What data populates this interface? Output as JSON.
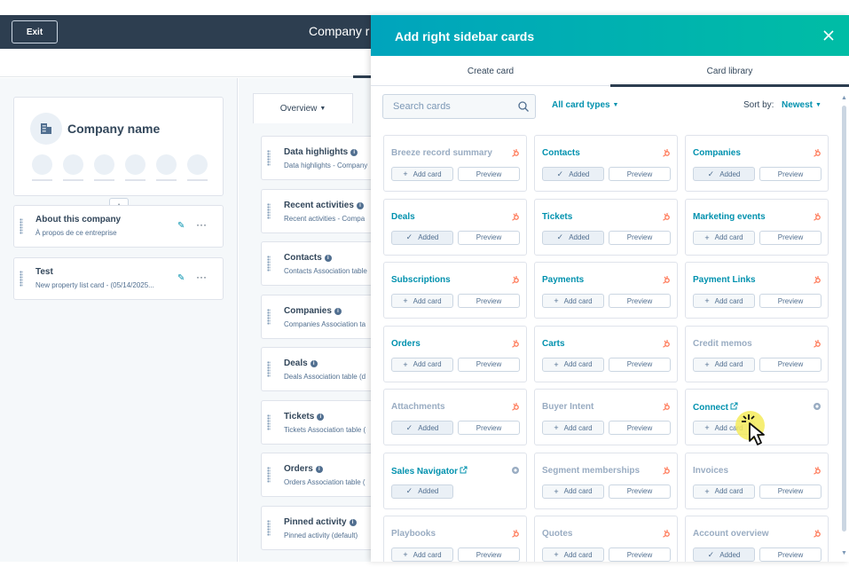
{
  "topbar": {
    "exit_label": "Exit",
    "title": "Company r"
  },
  "company_card": {
    "name": "Company name",
    "placeholder_count": 6
  },
  "left_cards": [
    {
      "title": "About this company",
      "subtitle": "À propos de ce entreprise"
    },
    {
      "title": "Test",
      "subtitle": "New property list card - (05/14/2025..."
    }
  ],
  "middle": {
    "tab_label": "Overview",
    "cards": [
      {
        "title": "Data highlights",
        "subtitle": "Data highlights - Company"
      },
      {
        "title": "Recent activities",
        "subtitle": "Recent activities - Compa"
      },
      {
        "title": "Contacts",
        "subtitle": "Contacts Association table"
      },
      {
        "title": "Companies",
        "subtitle": "Companies Association ta"
      },
      {
        "title": "Deals",
        "subtitle": "Deals Association table (d"
      },
      {
        "title": "Tickets",
        "subtitle": "Tickets Association table ("
      },
      {
        "title": "Orders",
        "subtitle": "Orders Association table ("
      },
      {
        "title": "Pinned activity",
        "subtitle": "Pinned activity (default)"
      }
    ]
  },
  "panel": {
    "title": "Add right sidebar cards",
    "tabs": [
      "Create card",
      "Card library"
    ],
    "active_tab": "Card library",
    "search_placeholder": "Search cards",
    "types_label": "All card types",
    "sort_label": "Sort by:",
    "sort_value": "Newest",
    "labels": {
      "add": "Add card",
      "added": "Added",
      "preview": "Preview"
    },
    "colors": {
      "accent": "#0091ae",
      "header_start": "#00a4bd",
      "header_end": "#00bda5",
      "badge": "#ff7a59"
    },
    "cards": [
      {
        "name": "Breeze record summary",
        "state": "add",
        "preview": true,
        "active": false,
        "badge": "hubspot-icon"
      },
      {
        "name": "Contacts",
        "state": "added",
        "preview": true,
        "active": true,
        "badge": "hubspot-icon"
      },
      {
        "name": "Companies",
        "state": "added",
        "preview": true,
        "active": true,
        "badge": "hubspot-icon"
      },
      {
        "name": "Deals",
        "state": "added",
        "preview": true,
        "active": true,
        "badge": "hubspot-icon"
      },
      {
        "name": "Tickets",
        "state": "added",
        "preview": true,
        "active": true,
        "badge": "hubspot-icon"
      },
      {
        "name": "Marketing events",
        "state": "add",
        "preview": true,
        "active": true,
        "badge": "hubspot-icon"
      },
      {
        "name": "Subscriptions",
        "state": "add",
        "preview": true,
        "active": true,
        "badge": "hubspot-icon"
      },
      {
        "name": "Payments",
        "state": "add",
        "preview": true,
        "active": true,
        "badge": "hubspot-icon"
      },
      {
        "name": "Payment Links",
        "state": "add",
        "preview": true,
        "active": true,
        "badge": "hubspot-icon"
      },
      {
        "name": "Orders",
        "state": "add",
        "preview": true,
        "active": true,
        "badge": "hubspot-icon"
      },
      {
        "name": "Carts",
        "state": "add",
        "preview": true,
        "active": true,
        "badge": "hubspot-icon"
      },
      {
        "name": "Credit memos",
        "state": "add",
        "preview": true,
        "active": false,
        "badge": "hubspot-icon"
      },
      {
        "name": "Attachments",
        "state": "added",
        "preview": true,
        "active": false,
        "badge": "hubspot-icon"
      },
      {
        "name": "Buyer Intent",
        "state": "add",
        "preview": true,
        "active": false,
        "badge": "hubspot-icon"
      },
      {
        "name": "Connect",
        "state": "add",
        "preview": false,
        "active": true,
        "badge": "app-icon",
        "external": true
      },
      {
        "name": "Sales Navigator",
        "state": "added",
        "preview": false,
        "active": true,
        "badge": "app-icon",
        "external": true
      },
      {
        "name": "Segment memberships",
        "state": "add",
        "preview": true,
        "active": false,
        "badge": "hubspot-icon"
      },
      {
        "name": "Invoices",
        "state": "add",
        "preview": true,
        "active": false,
        "badge": "hubspot-icon"
      },
      {
        "name": "Playbooks",
        "state": "add",
        "preview": true,
        "active": false,
        "badge": "hubspot-icon"
      },
      {
        "name": "Quotes",
        "state": "add",
        "preview": true,
        "active": false,
        "badge": "hubspot-icon"
      },
      {
        "name": "Account overview",
        "state": "added",
        "preview": true,
        "active": false,
        "badge": "hubspot-icon"
      }
    ]
  }
}
